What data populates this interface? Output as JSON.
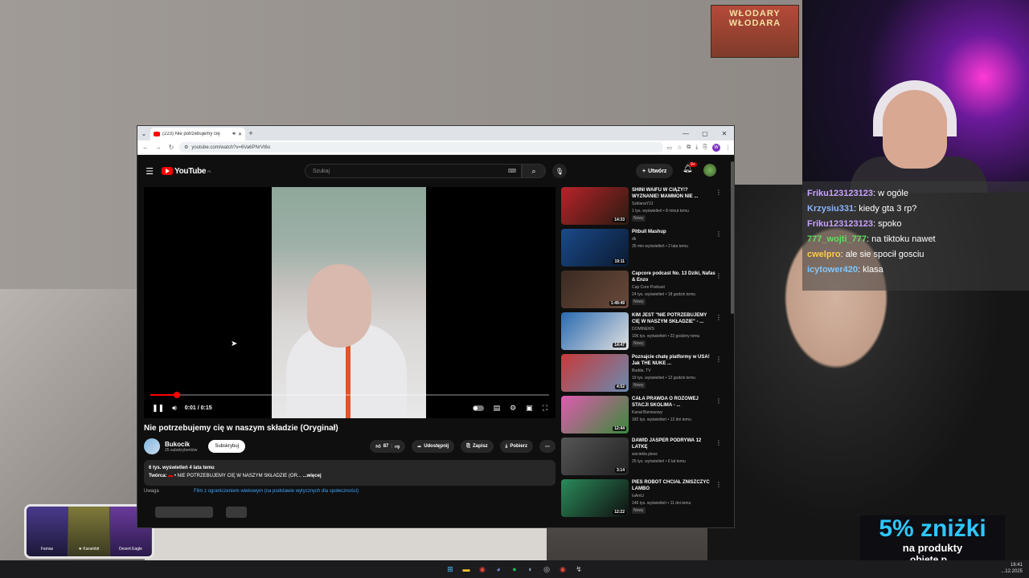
{
  "stream": {
    "poster_text": "WŁODARY WŁODARA",
    "chat": [
      {
        "user": "Friku123123123",
        "color": "#c8a2ff",
        "text": "w ogóle"
      },
      {
        "user": "Krzysiu331",
        "color": "#8ab4ff",
        "text": "kiedy gta 3 rp?"
      },
      {
        "user": "Friku123123123",
        "color": "#c8a2ff",
        "text": "spoko"
      },
      {
        "user": "777_wojti_777",
        "color": "#5fe05f",
        "text": "na tiktoku nawet"
      },
      {
        "user": "cwelpro",
        "color": "#ffcc44",
        "text": "ale sie spocił gosciu"
      },
      {
        "user": "icytower420",
        "color": "#7fc7ff",
        "text": "klasa"
      }
    ],
    "promo_big": "5% zniżki",
    "promo_line1": "na produkty",
    "promo_line2": "objęte p...",
    "cards": [
      "Famas",
      "★ Karambit",
      "Desert Eagle"
    ],
    "clock_time": "16:41",
    "clock_date": "...12.2025"
  },
  "browser": {
    "tab_title": "(223) Nie potrzebujemy cię",
    "url": "youtube.com/watch?v=6Va6PNrVt6o",
    "account_initial": "W"
  },
  "youtube": {
    "logo_text": "YouTube",
    "logo_region": "PL",
    "search_placeholder": "Szukaj",
    "create_label": "Utwórz",
    "notif_count": "9+",
    "time_display": "0:01 / 0:15",
    "progress_fraction": 0.067,
    "video_title": "Nie potrzebujemy cię w naszym składzie (Oryginał)",
    "channel_name": "Bukocik",
    "channel_subs": "25 subskrybentów",
    "subscribe_label": "Subskrybuj",
    "likes": "87",
    "share_label": "Udostępnij",
    "save_label": "Zapisz",
    "download_label": "Pobierz",
    "desc_stats": "6 tys. wyświetleń  4 lata temu",
    "desc_creator_label": "Twórca:",
    "desc_creator": "NIE POTRZEBUJEMY CIĘ W NASZYM SKŁADZIE (OR...",
    "desc_more": "...więcej",
    "warn_label": "Uwaga",
    "warn_link": "Film z ograniczeniem wiekowym (na podstawie wytycznych dla społeczności)",
    "sidebar": [
      {
        "title": "SHINI WAIFU W CIĄŻY!? WYZNANIE! MAMMON NIE ...",
        "channel": "SzklanaY2J",
        "meta": "1 tys. wyświetleń • 8 minut temu",
        "duration": "14:33",
        "new": "Nowy",
        "c1": "#b8232a",
        "c2": "#2a1a10"
      },
      {
        "title": "Pitbull Mashup",
        "channel": "dk",
        "meta": "35 min wyświetleń • 2 lata temu",
        "duration": "19:11",
        "new": "",
        "c1": "#1b4a8a",
        "c2": "#0a1a30"
      },
      {
        "title": "Capcore podcast No. 13 Dziki, Nafas & Enzo",
        "channel": "Cap Core Podcast",
        "meta": "24 tys. wyświetleń • 18 godzin temu",
        "duration": "1:49:49",
        "new": "Nowy",
        "c1": "#3a2a22",
        "c2": "#6a4a3a"
      },
      {
        "title": "KIM JEST \"NIE POTRZEBUJEMY CIĘ W NASZYM SKŁADZIE\" - ...",
        "channel": "DOMINEWS",
        "meta": "106 tys. wyświetleń • 22 godziny temu",
        "duration": "14:47",
        "new": "Nowy",
        "c1": "#2a6ab0",
        "c2": "#e0e0e0"
      },
      {
        "title": "Poznajcie chatę platformy w USA! Jak THE NUKE ...",
        "channel": "Budda. TV",
        "meta": "19 tys. wyświetleń • 12 godzin temu",
        "duration": "4:52",
        "new": "Nowy",
        "c1": "#c83a3a",
        "c2": "#6a8ab0"
      },
      {
        "title": "CAŁA PRAWDA O RÓŻOWEJ STACJI SKOLIMA - ...",
        "channel": "Kanał Biznesowy",
        "meta": "182 tys. wyświetleń • 12 dni temu",
        "duration": "12:44",
        "new": "",
        "c1": "#e05ab0",
        "c2": "#3a8a3a"
      },
      {
        "title": "DAWID JASPER PODRYWA 12 LATKĘ",
        "channel": "wsciekla piesc",
        "meta": "25 tys. wyświetleń • 6 lat temu",
        "duration": "3:14",
        "new": "",
        "c1": "#555555",
        "c2": "#222222"
      },
      {
        "title": "PIES ROBOT CHCIAŁ ZNISZCZYĆ LAMBO",
        "channel": "IsAmU",
        "meta": "146 tys. wyświetleń • 11 dni temu",
        "duration": "12:22",
        "new": "Nowy",
        "c1": "#2a8a5a",
        "c2": "#101010"
      }
    ]
  }
}
